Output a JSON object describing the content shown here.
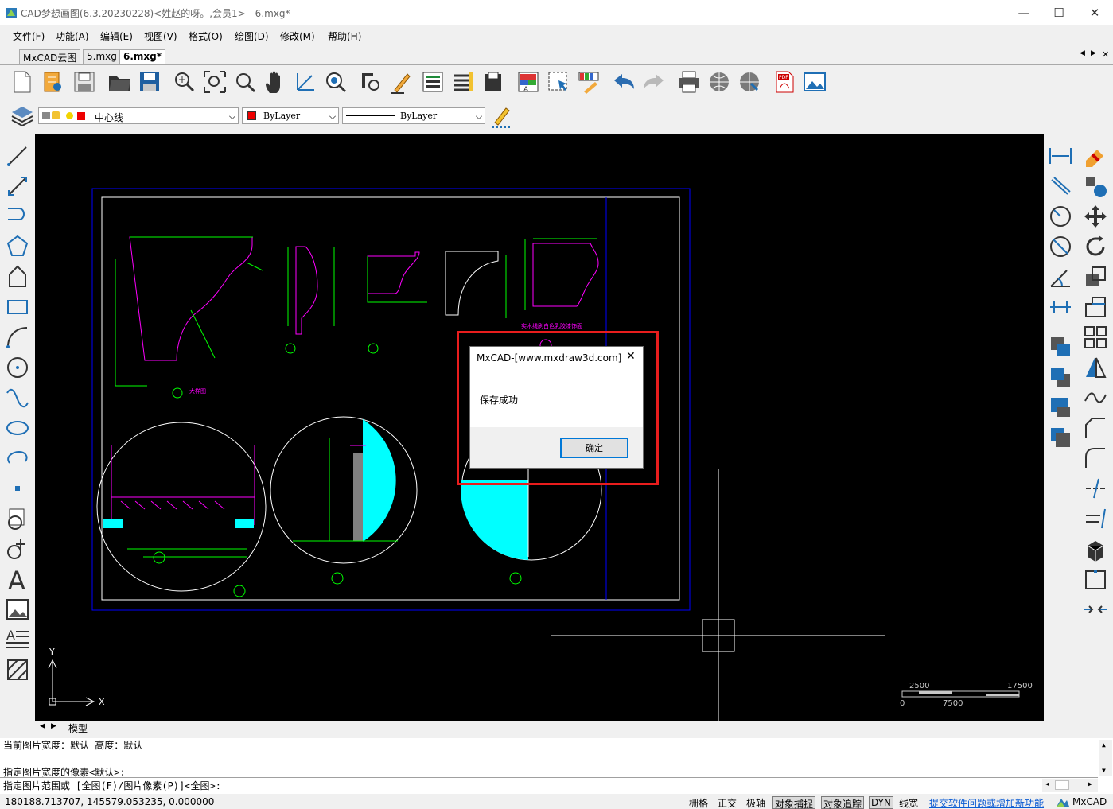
{
  "window": {
    "title": "CAD梦想画图(6.3.20230228)<姓赵的呀。,会员1> - 6.mxg*",
    "minimize": "—",
    "maximize": "☐",
    "close": "✕"
  },
  "menu": [
    "文件(F)",
    "功能(A)",
    "编辑(E)",
    "视图(V)",
    "格式(O)",
    "绘图(D)",
    "修改(M)",
    "帮助(H)"
  ],
  "tabs": [
    "MxCAD云图",
    "5.mxg",
    "6.mxg*"
  ],
  "tab_close": "✕",
  "tab_nav": [
    "◀",
    "▶"
  ],
  "layer_combo": {
    "value": "中心线"
  },
  "color_combo": {
    "value": "ByLayer"
  },
  "linetype_combo": {
    "value": "ByLayer"
  },
  "drawing": {
    "scale_labels": [
      "2500",
      "17500",
      "0",
      "7500"
    ],
    "ucs_x": "X",
    "ucs_y": "Y",
    "detail_label": "大样图"
  },
  "model_tab": "模型",
  "dialog": {
    "title": "MxCAD-[www.mxdraw3d.com]",
    "close": "✕",
    "message": "保存成功",
    "ok": "确定"
  },
  "command_lines": [
    "当前图片宽度：默认  高度：默认",
    "",
    "指定图片宽度的像素<默认>:",
    "指定图片范围或 [全图(F)/图片像素(P)]<全图>:"
  ],
  "status": {
    "coords": "180188.713707,  145579.053235,  0.000000",
    "buttons": [
      "栅格",
      "正交",
      "极轴",
      "对象捕捉",
      "对象追踪",
      "DYN",
      "线宽"
    ],
    "link": "提交软件问题或增加新功能",
    "brand": "MxCAD"
  },
  "colors": {
    "canvas": "#000000",
    "highlight": "#e81d1d",
    "cyan": "#00ffff",
    "magenta": "#ff00ff",
    "green": "#00ff00",
    "frame_blue": "#0000ff",
    "ok_border": "#0078d7"
  }
}
